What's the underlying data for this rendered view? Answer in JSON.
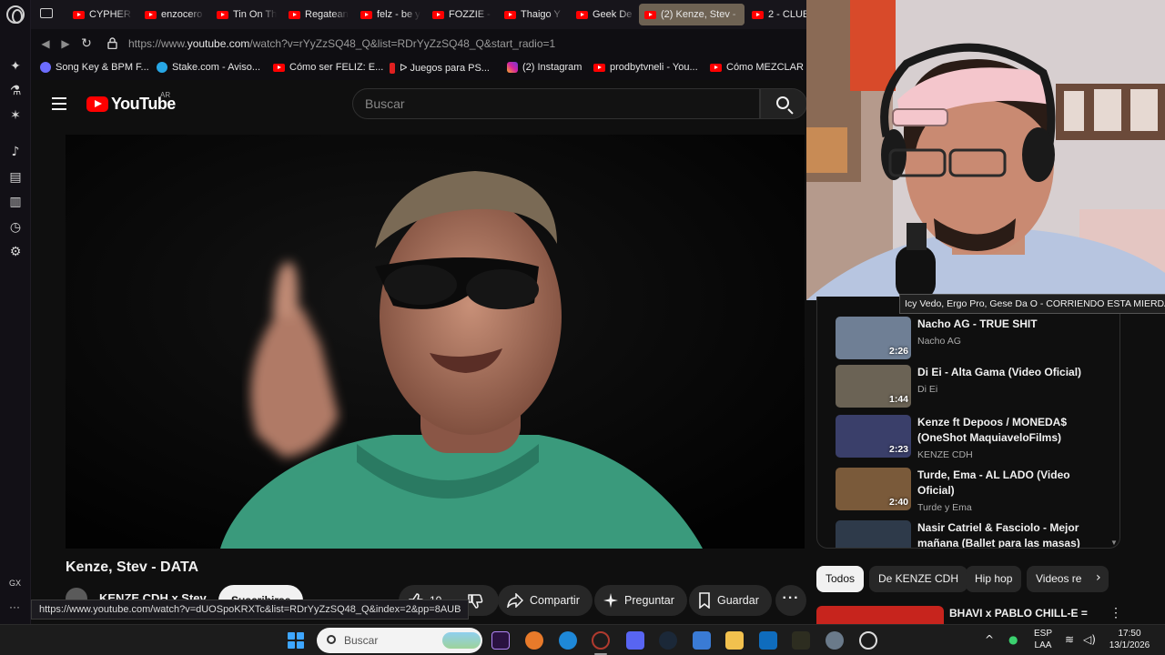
{
  "browser": {
    "tabs": [
      {
        "label": "CYPHER",
        "active": false
      },
      {
        "label": "enzocero",
        "active": false
      },
      {
        "label": "Tin On Th",
        "active": false
      },
      {
        "label": "Regatean",
        "active": false
      },
      {
        "label": "felz - be y",
        "active": false
      },
      {
        "label": "FOZZIE -",
        "active": false
      },
      {
        "label": "Thaigo Y",
        "active": false
      },
      {
        "label": "Geek De",
        "active": false
      },
      {
        "label": "(2) Kenze, Stev -",
        "active": true
      },
      {
        "label": "2 - CLUB",
        "active": false
      }
    ],
    "url_prefix": "https://www.",
    "url_domain": "youtube.com",
    "url_rest": "/watch?v=rYyZzSQ48_Q&list=RDrYyZzSQ48_Q&start_radio=1",
    "bookmarks": [
      {
        "label": "Song Key & BPM F...",
        "color": "#6c6cff"
      },
      {
        "label": "Stake.com - Aviso...",
        "color": "#27a6e5"
      },
      {
        "label": "Cómo ser FELIZ: E...",
        "color": "#ff0000"
      },
      {
        "label": "ᐅ Juegos para PS...",
        "color": "#e02020"
      },
      {
        "label": "(2) Instagram",
        "color": "#d6249f"
      },
      {
        "label": "prodbytvneli - You...",
        "color": "#ff0000"
      },
      {
        "label": "Cómo MEZCLAR V",
        "color": "#ff0000"
      }
    ],
    "sidebar_label": "GX",
    "sidebar_more": "···",
    "status_url": "https://www.youtube.com/watch?v=dUOSpoKRXTc&list=RDrYyZzSQ48_Q&index=2&pp=8AUB"
  },
  "youtube": {
    "logo_text": "YouTube",
    "country_code": "AR",
    "search_placeholder": "Buscar",
    "video": {
      "title": "Kenze, Stev - DATA",
      "channel": "KENZE CDH x Stev",
      "subscribe_label": "Suscribirse",
      "like_count": "10",
      "share_label": "Compartir",
      "ask_label": "Preguntar",
      "save_label": "Guardar"
    },
    "tooltip": "Icy Vedo, Ergo Pro, Gese Da O - CORRIENDO ESTA MIERDA",
    "playlist": [
      {
        "title": "Nacho AG - TRUE SHIT",
        "channel": "Nacho AG",
        "duration": "2:26",
        "thumb_color": "#6f7f95"
      },
      {
        "title": "Di Ei - Alta Gama (Video Oficial)",
        "channel": "Di Ei",
        "duration": "1:44",
        "thumb_color": "#6b6355"
      },
      {
        "title": "Kenze ft Depoos / MONEDA$ (OneShot MaquiaveloFilms)",
        "channel": "KENZE CDH",
        "duration": "2:23",
        "thumb_color": "#3a3f6a"
      },
      {
        "title": "Turde, Ema - AL LADO (Video Oficial)",
        "channel": "Turde y Ema",
        "duration": "2:40",
        "thumb_color": "#7a5a3a"
      },
      {
        "title": "Nasir Catriel & Fasciolo - Mejor mañana (Ballet para las masas)",
        "channel": "",
        "duration": "",
        "thumb_color": "#2e3a4a"
      }
    ],
    "chips": [
      {
        "label": "Todos",
        "active": true
      },
      {
        "label": "De KENZE CDH",
        "active": false
      },
      {
        "label": "Hip hop",
        "active": false
      },
      {
        "label": "Videos re",
        "active": false
      }
    ],
    "next_video_title": "BHAVI x PABLO CHILL-E ="
  },
  "taskbar": {
    "search_label": "Buscar",
    "lang_top": "ESP",
    "lang_bottom": "LAA",
    "time": "17:50",
    "date": "13/1/2026"
  }
}
